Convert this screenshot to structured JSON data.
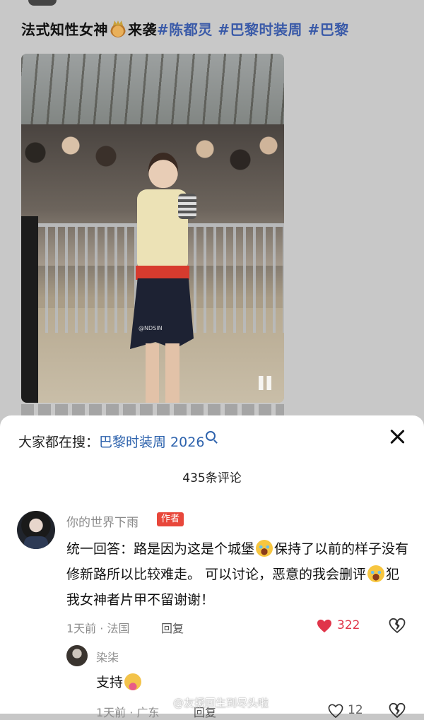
{
  "post": {
    "title_text": "法式知性女神",
    "title_after_emoji": "来袭",
    "tags": [
      "#陈都灵",
      "#巴黎时装周",
      "#巴黎"
    ],
    "photo_watermark": "@NDSIN"
  },
  "sheet": {
    "search_prefix": "大家都在搜：",
    "search_term": "巴黎时装周 2026",
    "comment_count": "435条评论"
  },
  "comments": [
    {
      "username": "你的世界下雨",
      "badge": "作者",
      "text_part1": "统一回答：路是因为这是个城堡",
      "text_part2": "保持了以前的样子没有修新路所以比较难走。 可以讨论，恶意的我会删评",
      "text_part3": "犯我女神者片甲不留谢谢！",
      "meta": "1天前 · 法国",
      "reply_label": "回复",
      "likes": "322",
      "liked": true,
      "like_color": "#e0354a"
    },
    {
      "username": "染柒",
      "text": "支持",
      "meta": "1天前 · 广东",
      "reply_label": "回复",
      "likes": "12",
      "liked": false
    }
  ],
  "watermark": "@友援回生到尽头啦",
  "icons": {
    "close": "close-icon",
    "search": "search-icon",
    "heart": "heart-icon",
    "dislike": "broken-heart-icon",
    "pause": "pause-icon"
  },
  "colors": {
    "link_blue": "#2e63ad",
    "badge_red": "#e8473b",
    "like_red": "#e0354a"
  }
}
